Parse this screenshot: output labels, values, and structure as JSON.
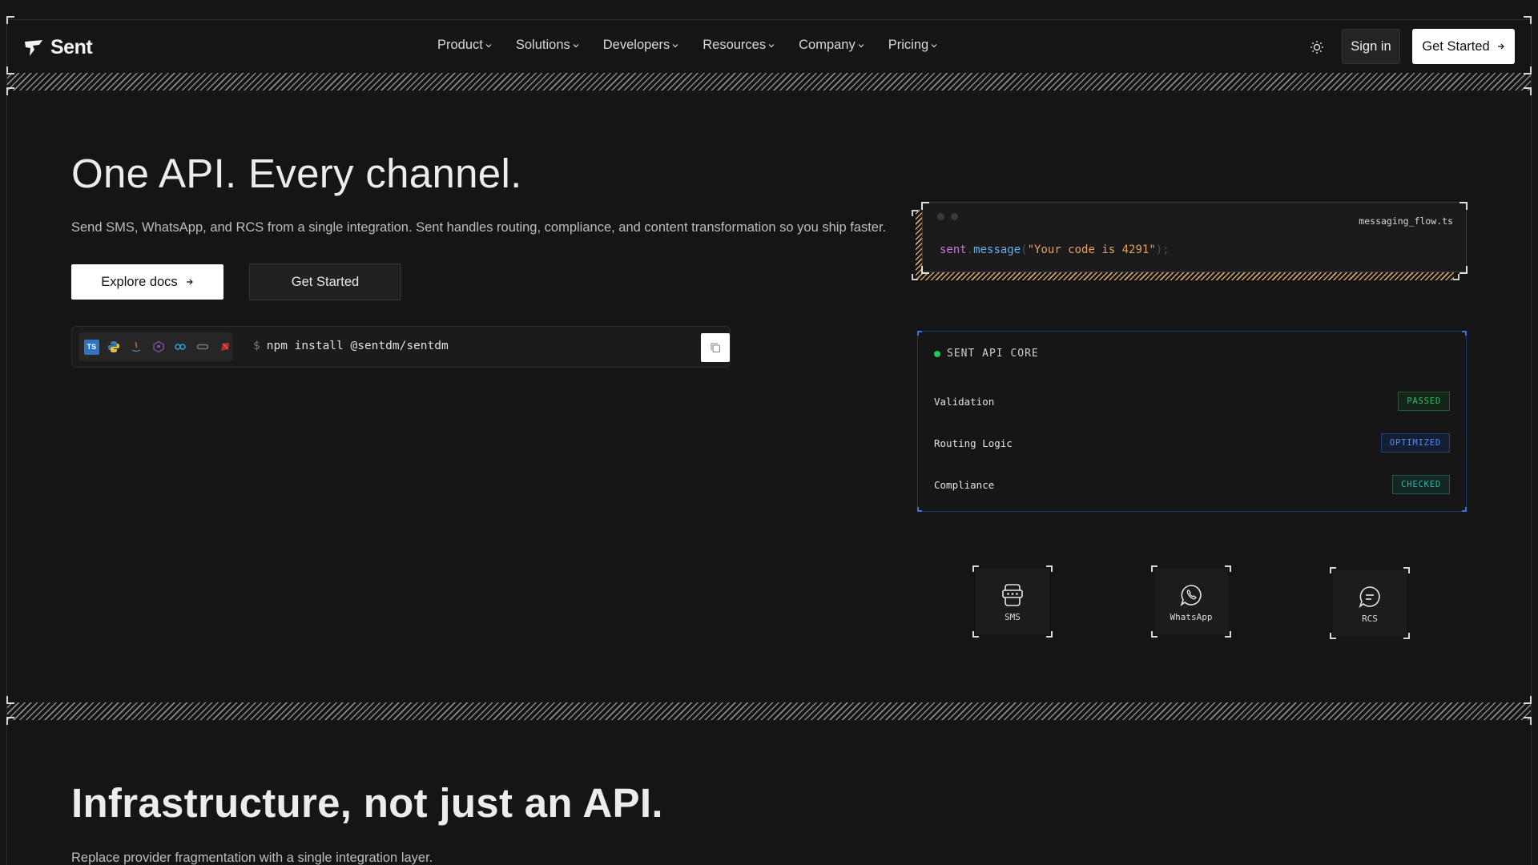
{
  "header": {
    "logo_text": "Sent",
    "nav": [
      {
        "label": "Product"
      },
      {
        "label": "Solutions"
      },
      {
        "label": "Developers"
      },
      {
        "label": "Resources"
      },
      {
        "label": "Company"
      },
      {
        "label": "Pricing"
      }
    ],
    "theme_icon": "sun-icon",
    "signin_label": "Sign in",
    "get_started_label": "Get Started"
  },
  "hero": {
    "title": "One API. Every channel.",
    "subtitle": "Send SMS, WhatsApp, and RCS from a single integration. Sent handles routing, compliance, and content transformation so you ship faster.",
    "explore_label": "Explore docs",
    "get_started_label": "Get Started",
    "install": {
      "languages": [
        "TS",
        "python",
        "java",
        "php",
        "go",
        "link",
        "ruby"
      ],
      "prompt": "$",
      "command": "npm install @sentdm/sentdm"
    }
  },
  "code_card": {
    "filename": "messaging_flow.ts",
    "tokens": {
      "object": "sent",
      "dot": ".",
      "method": "message",
      "open": "(",
      "arg": "\"Your code is 4291\"",
      "close": ");"
    }
  },
  "core": {
    "title": "SENT API CORE",
    "rows": [
      {
        "label": "Validation",
        "status": "PASSED",
        "color": "#22c55e"
      },
      {
        "label": "Routing Logic",
        "status": "OPTIMIZED",
        "color": "#3b82f6"
      },
      {
        "label": "Compliance",
        "status": "CHECKED",
        "color": "#14b8a6"
      }
    ]
  },
  "channels": [
    {
      "label": "SMS",
      "icon": "sms-icon"
    },
    {
      "label": "WhatsApp",
      "icon": "whatsapp-icon"
    },
    {
      "label": "RCS",
      "icon": "rcs-chat-icon"
    }
  ],
  "section2": {
    "title": "Infrastructure, not just an API.",
    "subtitle": "Replace provider fragmentation with a single integration layer."
  }
}
